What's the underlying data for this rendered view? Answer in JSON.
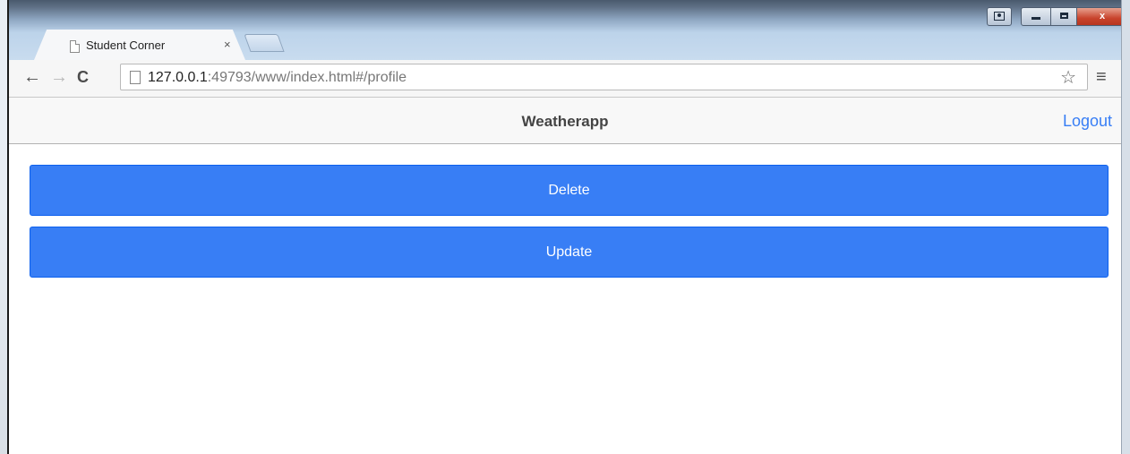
{
  "browser": {
    "tab_title": "Student Corner",
    "tab_close": "×",
    "url_host": "127.0.0.1",
    "url_rest": ":49793/www/index.html#/profile",
    "close_glyph": "x"
  },
  "app": {
    "title": "Weatherapp",
    "logout_label": "Logout",
    "buttons": {
      "delete_label": "Delete",
      "update_label": "Update"
    },
    "colors": {
      "accent": "#387ef5",
      "header_bg": "#f8f8f8"
    }
  }
}
